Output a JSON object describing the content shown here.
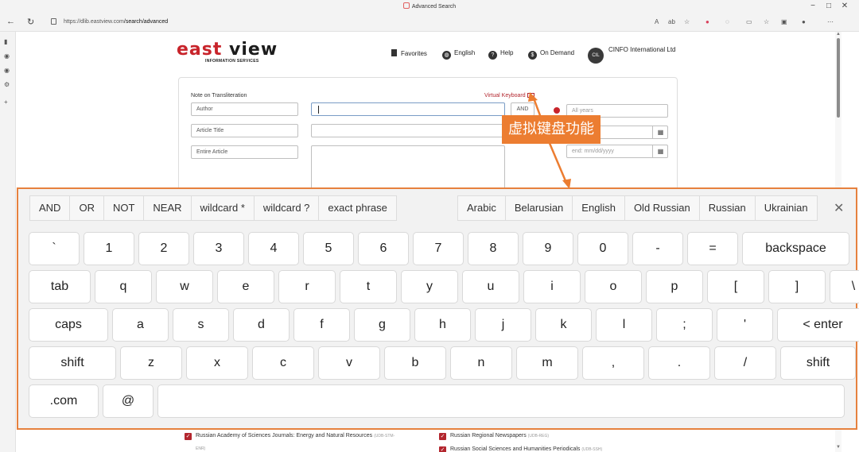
{
  "browser": {
    "window_title": "Advanced Search",
    "url_host": "https://dlib.eastview.com",
    "url_path": "/search/advanced",
    "window_controls": [
      "−",
      "□",
      "✕"
    ],
    "toolbar_text": "A",
    "toolbar_text2": "ab"
  },
  "site": {
    "logo_main_a": "east ",
    "logo_main_b": "view",
    "logo_sub": "INFORMATION SERVICES",
    "nav": {
      "favorites": "Favorites",
      "language": "English",
      "help": "Help",
      "on_demand": "On Demand",
      "account_initials": "CIL",
      "account_name": "CINFO International Ltd"
    }
  },
  "search_form": {
    "note_label": "Note on Transliteration",
    "virtual_keyboard_link": "Virtual Keyboard",
    "fields": [
      "Author",
      "Article Title",
      "Entire Article"
    ],
    "and_button": "AND",
    "date_all": "All years",
    "date_end_placeholder": "end: mm/dd/yyyy"
  },
  "callout": {
    "text": "虚拟键盘功能",
    "color": "#ec7d31"
  },
  "virtual_keyboard": {
    "operators": [
      "AND",
      "OR",
      "NOT",
      "NEAR",
      "wildcard *",
      "wildcard ?",
      "exact phrase"
    ],
    "languages": [
      "Arabic",
      "Belarusian",
      "English",
      "Old Russian",
      "Russian",
      "Ukrainian"
    ],
    "close": "✕",
    "rows": [
      [
        "`",
        "1",
        "2",
        "3",
        "4",
        "5",
        "6",
        "7",
        "8",
        "9",
        "0",
        "-",
        "=",
        "backspace"
      ],
      [
        "tab",
        "q",
        "w",
        "e",
        "r",
        "t",
        "y",
        "u",
        "i",
        "o",
        "p",
        "[",
        "]",
        "\\"
      ],
      [
        "caps",
        "a",
        "s",
        "d",
        "f",
        "g",
        "h",
        "j",
        "k",
        "l",
        ";",
        "'",
        "< enter"
      ],
      [
        "shift",
        "z",
        "x",
        "c",
        "v",
        "b",
        "n",
        "m",
        ",",
        ".",
        "/",
        "shift"
      ],
      [
        ".com",
        "@",
        ""
      ]
    ]
  },
  "collections": [
    {
      "label": "Russian Academy of Sciences Journals: Energy and Natural Resources",
      "code": "(UDB-STM-"
    },
    {
      "label": "ENR)",
      "code": ""
    },
    {
      "label": "Russian Regional Newspapers",
      "code": "(UDB-REG)"
    },
    {
      "label": "Russian Social Sciences and Humanities Periodicals",
      "code": "(UDB-SSH)"
    }
  ]
}
